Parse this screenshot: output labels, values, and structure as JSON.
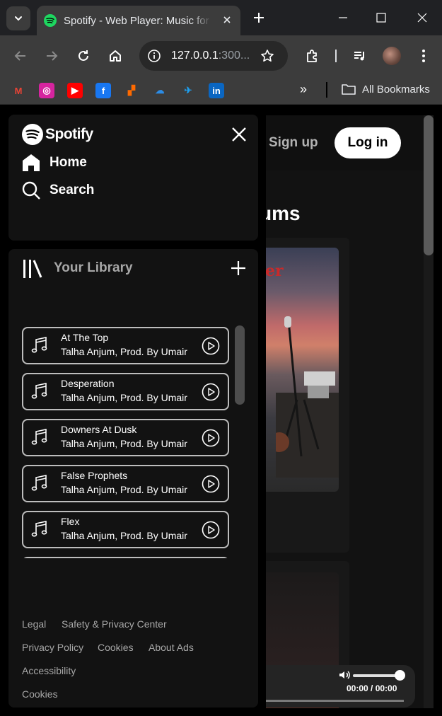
{
  "browser": {
    "tab_title": "Spotify - Web Player: Music for everyone",
    "url_host": "127.0.0.1",
    "url_rest": ":300...",
    "all_bookmarks": "All Bookmarks"
  },
  "bookmarks": [
    {
      "name": "gmail-icon",
      "glyph": "M",
      "color": "#ea4335",
      "bg": "transparent"
    },
    {
      "name": "instagram-icon",
      "glyph": "◎",
      "color": "#fff",
      "bg": "#d6249f"
    },
    {
      "name": "youtube-icon",
      "glyph": "▶",
      "color": "#fff",
      "bg": "#ff0000"
    },
    {
      "name": "facebook-icon",
      "glyph": "f",
      "color": "#fff",
      "bg": "#1877f2"
    },
    {
      "name": "app-icon",
      "glyph": "▞",
      "color": "#ff6a00",
      "bg": "transparent"
    },
    {
      "name": "onedrive-icon",
      "glyph": "☁",
      "color": "#2b8ce6",
      "bg": "transparent"
    },
    {
      "name": "bird-icon",
      "glyph": "✈",
      "color": "#1da1f2",
      "bg": "transparent"
    },
    {
      "name": "linkedin-icon",
      "glyph": "in",
      "color": "#fff",
      "bg": "#0a66c2"
    }
  ],
  "brand": {
    "name": "Spotify",
    "accent": "#1ed760"
  },
  "nav": {
    "home": "Home",
    "search": "Search"
  },
  "header": {
    "signup": "Sign up",
    "login": "Log in"
  },
  "main": {
    "section_title_fragment": "ums",
    "card_text_fragment": "er"
  },
  "library": {
    "title": "Your Library",
    "tracks": [
      {
        "name": "At The Top",
        "artist": "Talha Anjum, Prod. By Umair"
      },
      {
        "name": "Desperation",
        "artist": "Talha Anjum, Prod. By Umair"
      },
      {
        "name": "Downers At Dusk",
        "artist": "Talha Anjum, Prod. By Umair"
      },
      {
        "name": "False Prophets",
        "artist": "Talha Anjum, Prod. By Umair"
      },
      {
        "name": "Flex",
        "artist": "Talha Anjum, Prod. By Umair"
      }
    ]
  },
  "player": {
    "time": "00:00 / 00:00"
  },
  "footer": {
    "legal": "Legal",
    "safety": "Safety & Privacy Center",
    "privacy": "Privacy Policy",
    "cookies": "Cookies",
    "about_ads": "About Ads",
    "accessibility": "Accessibility",
    "cookies2": "Cookies"
  }
}
